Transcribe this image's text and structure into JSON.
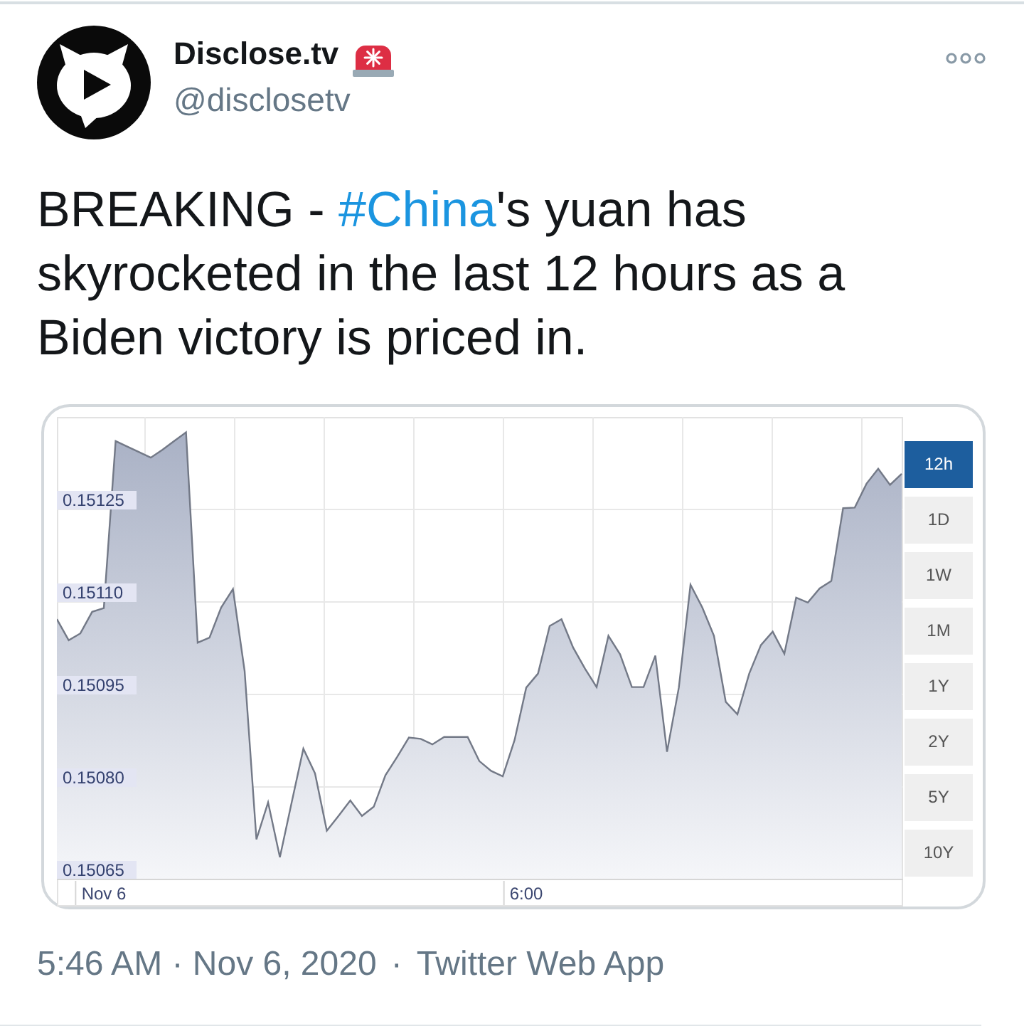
{
  "tweet": {
    "author": {
      "name": "Disclose.tv",
      "handle": "@disclosetv"
    },
    "text": [
      {
        "kind": "text",
        "text": "BREAKING - "
      },
      {
        "kind": "hashtag",
        "text": "#China"
      },
      {
        "kind": "text",
        "text": "'s yuan has skyrocketed in the last 12 hours as a Biden victory is priced in."
      }
    ],
    "chart": {
      "range_buttons": [
        {
          "label": "12h",
          "selected": true
        },
        {
          "label": "1D",
          "selected": false
        },
        {
          "label": "1W",
          "selected": false
        },
        {
          "label": "1M",
          "selected": false
        },
        {
          "label": "1Y",
          "selected": false
        },
        {
          "label": "2Y",
          "selected": false
        },
        {
          "label": "5Y",
          "selected": false
        },
        {
          "label": "10Y",
          "selected": false
        }
      ],
      "chart_data": {
        "type": "area",
        "grid": true,
        "categories": [
          null,
          null,
          null,
          null,
          "Nov 6",
          null,
          null,
          null,
          null,
          null,
          null,
          null,
          null,
          null,
          null,
          null,
          null,
          null,
          null,
          null,
          null,
          null,
          null,
          null,
          null,
          null,
          null,
          null,
          null,
          null,
          null,
          null,
          null,
          null,
          null,
          null,
          null,
          null,
          null,
          null,
          "6:00",
          null,
          null,
          null,
          null,
          null,
          null,
          null,
          null,
          null,
          null,
          null,
          null,
          null,
          null,
          null,
          null,
          null,
          null,
          null,
          null,
          null,
          null,
          null,
          null,
          null,
          null,
          null,
          null,
          null,
          null,
          null,
          null
        ],
        "series": [
          {
            "color": "#737987",
            "values": [
              0.151072,
              0.151038,
              0.151049,
              0.151084,
              0.15109,
              0.151361,
              0.151352,
              0.151343,
              0.151334,
              0.151347,
              0.151361,
              0.151375,
              0.151034,
              0.151042,
              0.151091,
              0.151121,
              0.150988,
              0.150715,
              0.150775,
              0.150686,
              0.150774,
              0.150862,
              0.150822,
              0.150729,
              0.150753,
              0.150778,
              0.150753,
              0.150768,
              0.150819,
              0.150849,
              0.15088,
              0.150878,
              0.150869,
              0.150881,
              0.150881,
              0.150881,
              0.150842,
              0.150826,
              0.150817,
              0.150876,
              0.150961,
              0.150984,
              0.151061,
              0.151072,
              0.151026,
              0.150992,
              0.150962,
              0.151045,
              0.151015,
              0.150962,
              0.150962,
              0.151013,
              0.150857,
              0.150961,
              0.151128,
              0.151091,
              0.151045,
              0.150938,
              0.150918,
              0.150984,
              0.15103,
              0.151052,
              0.151016,
              0.151107,
              0.151099,
              0.151122,
              0.151134,
              0.151252,
              0.151253,
              0.151292,
              0.151316,
              0.15129,
              0.151308
            ]
          }
        ],
        "ylim": [
          0.15065,
          0.1514
        ],
        "yticks": [
          0.15065,
          {
            "value": 0.1508,
            "label": "0.15080"
          },
          0.15095,
          {
            "value": 0.1511,
            "label": "0.15110"
          },
          0.15125
        ]
      }
    },
    "footer": {
      "timestamp": "5:46 AM · Nov 6, 2020",
      "separator": "·",
      "source": "Twitter Web App"
    }
  }
}
